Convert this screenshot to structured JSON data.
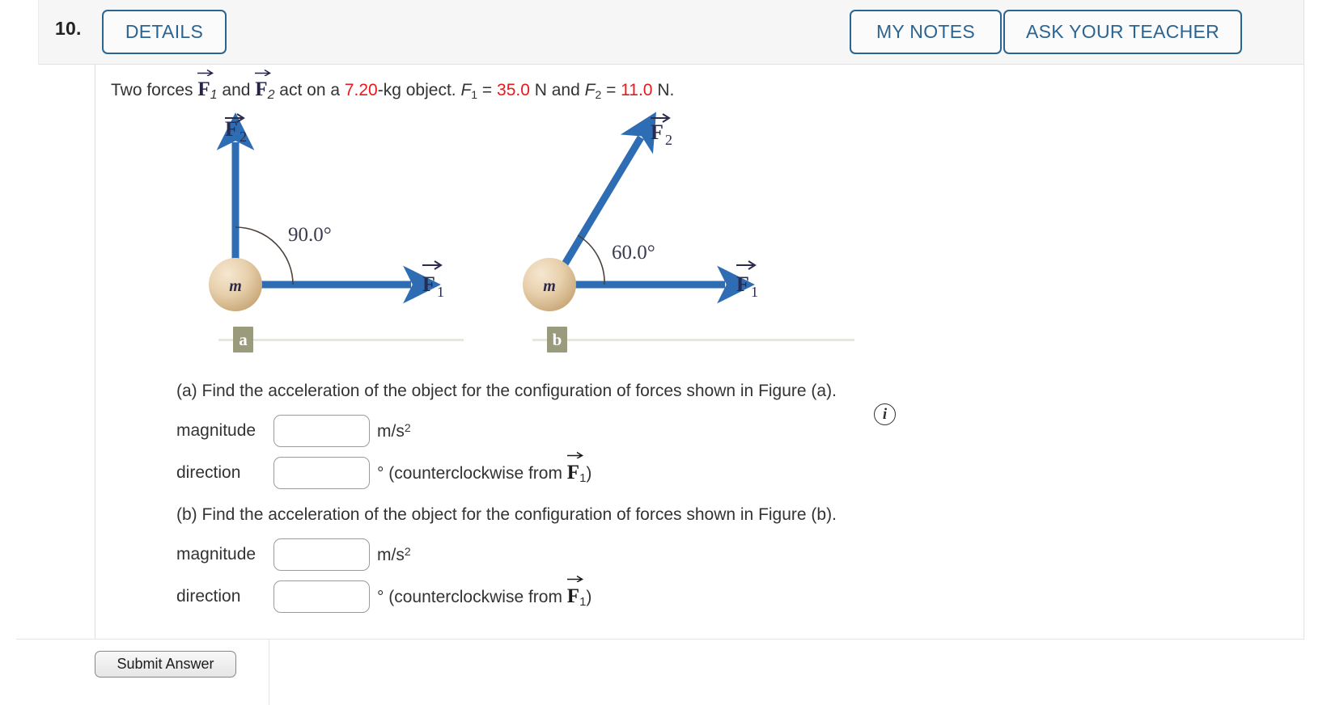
{
  "header": {
    "question_number": "10.",
    "details_label": "DETAILS",
    "my_notes_label": "MY NOTES",
    "ask_teacher_label": "ASK YOUR TEACHER"
  },
  "problem": {
    "text_1": "Two forces ",
    "vec_F": "F",
    "sub_1": "1",
    "text_2": " and ",
    "sub_2": "2",
    "text_3": " act on a ",
    "mass": "7.20",
    "text_4": "-kg object. ",
    "F1_symbol": "F",
    "F1_sub": "1",
    "eq": " = ",
    "F1_value": "35.0",
    "unit_N": " N and ",
    "F2_symbol": "F",
    "F2_sub": "2",
    "F2_value": "11.0",
    "unit_N_end": " N."
  },
  "figure": {
    "mass_label": "m",
    "vector_F1": "F",
    "vector_F1_sub": "1",
    "vector_F2": "F",
    "vector_F2_sub": "2",
    "angle_a": "90.0°",
    "angle_b": "60.0°",
    "caption_a": "a",
    "caption_b": "b",
    "info_icon": "i",
    "arrow_color": "#2E6DB4",
    "ball_color": "#e3cba6",
    "label_color": "#2d2d4e",
    "rule_color": "#e9e7db",
    "tag_color": "#9a9a7c"
  },
  "parts": [
    {
      "title": "(a) Find the acceleration of the object for the configuration of forces shown in Figure (a).",
      "magnitude_label": "magnitude",
      "magnitude_value": "",
      "magnitude_unit_base": "m/s",
      "magnitude_unit_exp": "2",
      "direction_label": "direction",
      "direction_value": "",
      "direction_unit": "° (counterclockwise from ",
      "direction_vec": "F",
      "direction_vec_sub": "1",
      "direction_close": ")"
    },
    {
      "title": "(b) Find the acceleration of the object for the configuration of forces shown in Figure (b).",
      "magnitude_label": "magnitude",
      "magnitude_value": "",
      "magnitude_unit_base": "m/s",
      "magnitude_unit_exp": "2",
      "direction_label": "direction",
      "direction_value": "",
      "direction_unit": "° (counterclockwise from ",
      "direction_vec": "F",
      "direction_vec_sub": "1",
      "direction_close": ")"
    }
  ],
  "footer": {
    "submit_label": "Submit Answer"
  }
}
